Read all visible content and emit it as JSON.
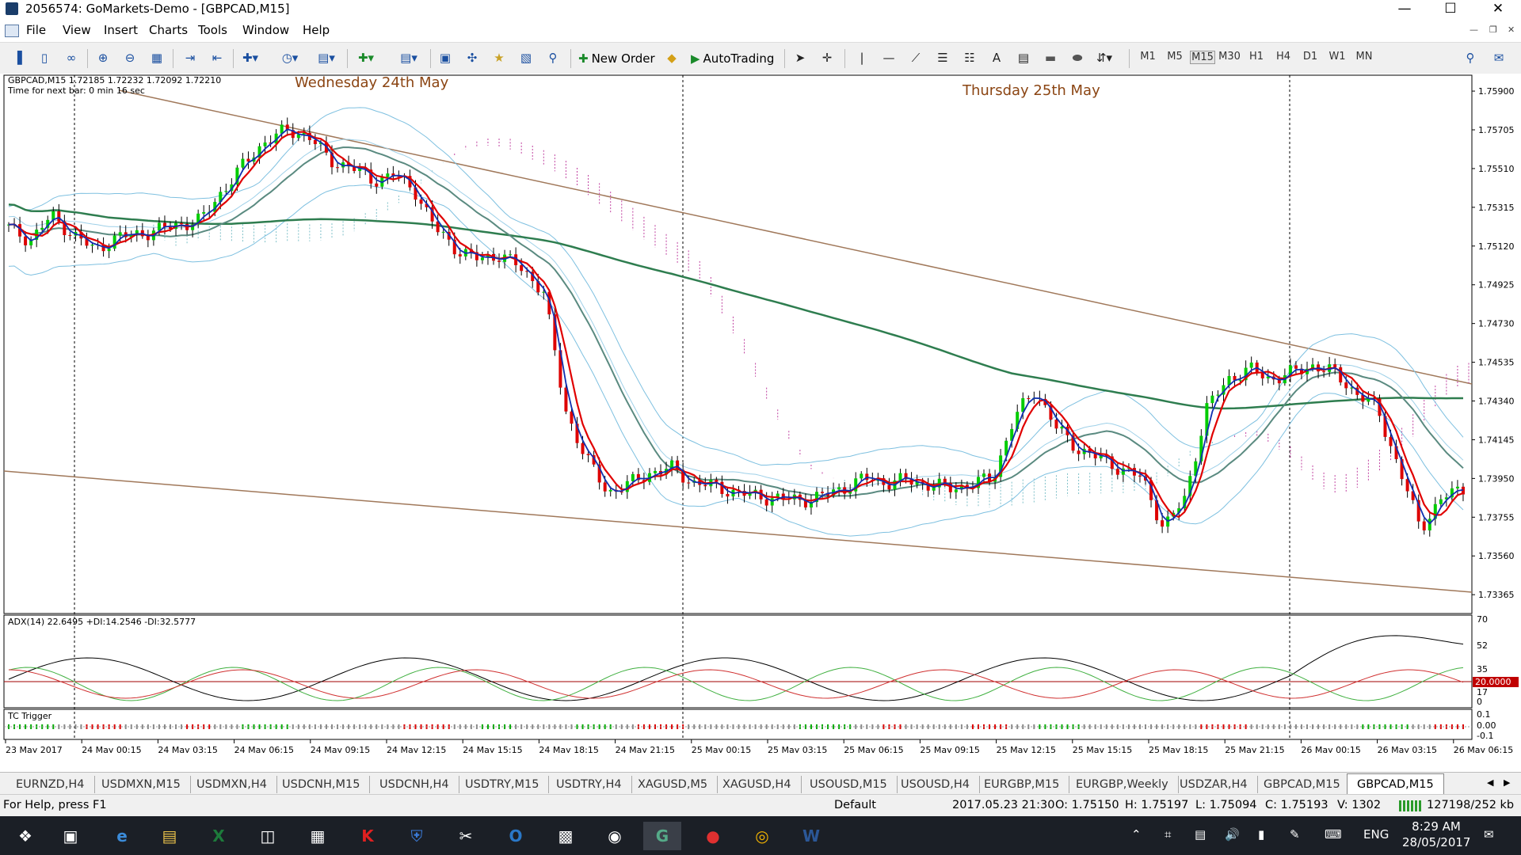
{
  "window": {
    "title": "2056574: GoMarkets-Demo - [GBPCAD,M15]"
  },
  "menu": [
    "File",
    "View",
    "Insert",
    "Charts",
    "Tools",
    "Window",
    "Help"
  ],
  "toolbar": {
    "new_order": "New Order",
    "autotrading": "AutoTrading",
    "timeframes": [
      "M1",
      "M5",
      "M15",
      "M30",
      "H1",
      "H4",
      "D1",
      "W1",
      "MN"
    ],
    "active_timeframe": "M15"
  },
  "chart": {
    "symbol_line": "GBPCAD,M15  1.72185 1.72232 1.72092 1.72210",
    "timer_line": "Time for next bar: 0 min 16 sec",
    "annotations": [
      "Wednesday 24th May",
      "Thursday 25th May"
    ],
    "price_labels": [
      "1.75900",
      "1.75705",
      "1.75510",
      "1.75315",
      "1.75120",
      "1.74925",
      "1.74730",
      "1.74535",
      "1.74340",
      "1.74145",
      "1.73950",
      "1.73755",
      "1.73560",
      "1.73365"
    ],
    "adx_label": "ADX(14) 22.6495 +DI:14.2546 -DI:32.5777",
    "adx_scale": [
      "70",
      "52",
      "35",
      "20.0000",
      "17",
      "0"
    ],
    "tc_label": "TC Trigger",
    "tc_scale": [
      "0.1",
      "0.00",
      "-0.1"
    ],
    "time_labels": [
      "23 May 2017",
      "24 May 00:15",
      "24 May 03:15",
      "24 May 06:15",
      "24 May 09:15",
      "24 May 12:15",
      "24 May 15:15",
      "24 May 18:15",
      "24 May 21:15",
      "25 May 00:15",
      "25 May 03:15",
      "25 May 06:15",
      "25 May 09:15",
      "25 May 12:15",
      "25 May 15:15",
      "25 May 18:15",
      "25 May 21:15",
      "26 May 00:15",
      "26 May 03:15",
      "26 May 06:15"
    ],
    "colors": {
      "price_line_red": "#e00000",
      "price_line_blue": "#1030b0",
      "ema": "#2e7d4f",
      "bands": "#7ec0e0",
      "cloud": "#c040a0",
      "trendline": "#a0785a",
      "annotation": "#8b4513",
      "bull": "#00cc00",
      "bear": "#dd0000"
    }
  },
  "chart_data": {
    "type": "candlestick",
    "title": "GBPCAD,M15",
    "price_range": [
      1.7327,
      1.7598
    ],
    "closes": [
      1.7521,
      1.7515,
      1.7527,
      1.7518,
      1.751,
      1.7516,
      1.7518,
      1.752,
      1.7523,
      1.7525,
      1.754,
      1.7553,
      1.7565,
      1.757,
      1.7568,
      1.7555,
      1.7552,
      1.7545,
      1.7548,
      1.754,
      1.752,
      1.751,
      1.7505,
      1.7508,
      1.75,
      1.749,
      1.743,
      1.7405,
      1.7388,
      1.7392,
      1.7398,
      1.74,
      1.7393,
      1.7391,
      1.7388,
      1.7386,
      1.7385,
      1.7384,
      1.7386,
      1.739,
      1.7395,
      1.7393,
      1.7394,
      1.7392,
      1.739,
      1.7392,
      1.7395,
      1.7425,
      1.744,
      1.742,
      1.741,
      1.7405,
      1.74,
      1.7395,
      1.737,
      1.7385,
      1.743,
      1.7445,
      1.745,
      1.7445,
      1.7448,
      1.7452,
      1.7448,
      1.7438,
      1.743,
      1.74,
      1.737,
      1.7385,
      1.739
    ]
  },
  "tabs": [
    "EURNZD,H4",
    "USDMXN,M15",
    "USDMXN,H4",
    "USDCNH,M15",
    "USDCNH,H4",
    "USDTRY,M15",
    "USDTRY,H4",
    "XAGUSD,M5",
    "XAGUSD,H4",
    "USOUSD,M15",
    "USOUSD,H4",
    "EURGBP,M15",
    "EURGBP,Weekly",
    "USDZAR,H4",
    "GBPCAD,M15",
    "GBPCAD,M15"
  ],
  "active_tab": "GBPCAD,M15",
  "status": {
    "help": "For Help, press F1",
    "profile": "Default",
    "datetime": "2017.05.23 21:30",
    "open": "O: 1.75150",
    "high": "H: 1.75197",
    "low": "L: 1.75094",
    "close": "C: 1.75193",
    "volume": "V: 1302",
    "traffic": "127198/252 kb"
  },
  "taskbar": {
    "lang": "ENG",
    "time": "8:29 AM",
    "date": "28/05/2017"
  }
}
